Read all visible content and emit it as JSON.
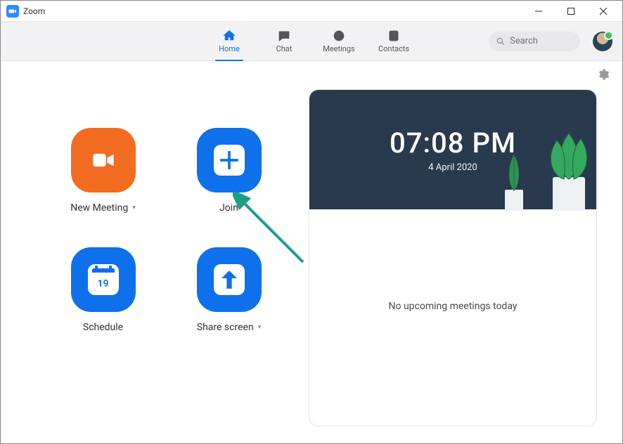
{
  "window": {
    "title": "Zoom"
  },
  "nav": {
    "items": [
      {
        "label": "Home",
        "active": true
      },
      {
        "label": "Chat",
        "active": false
      },
      {
        "label": "Meetings",
        "active": false
      },
      {
        "label": "Contacts",
        "active": false
      }
    ],
    "search_placeholder": "Search"
  },
  "actions": {
    "new_meeting": {
      "label": "New Meeting"
    },
    "join": {
      "label": "Join"
    },
    "schedule": {
      "label": "Schedule",
      "day_number": "19"
    },
    "share_screen": {
      "label": "Share screen"
    }
  },
  "panel": {
    "time": "07:08 PM",
    "date": "4 April 2020",
    "empty_state": "No upcoming meetings today"
  },
  "colors": {
    "accent_blue": "#0e71eb",
    "accent_orange": "#f26d21",
    "hero_bg": "#2a3a4e"
  }
}
